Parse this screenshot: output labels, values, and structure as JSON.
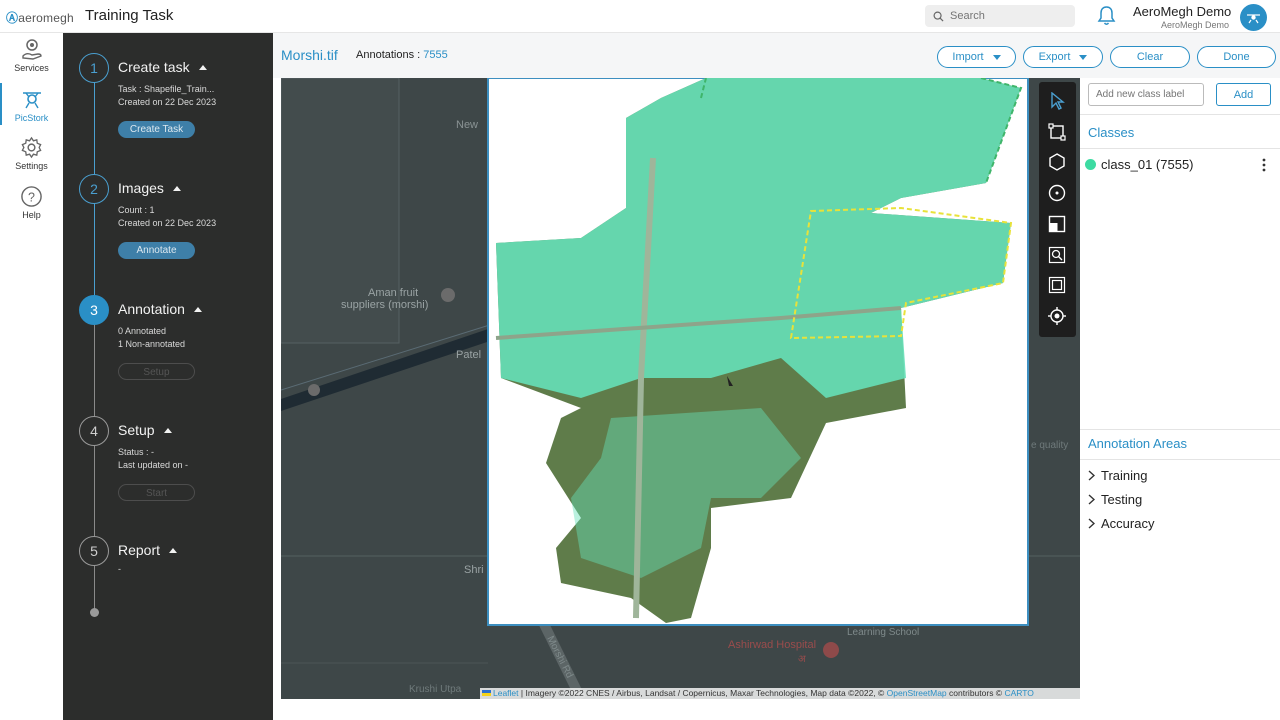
{
  "app": {
    "logo": "aeromegh",
    "title": "Training Task"
  },
  "search": {
    "placeholder": "Search"
  },
  "user": {
    "name": "AeroMegh Demo",
    "subtitle": "AeroMegh Demo"
  },
  "nav": {
    "services": "Services",
    "picstork": "PicStork",
    "settings": "Settings",
    "help": "Help"
  },
  "steps": [
    {
      "num": "1",
      "title": "Create task",
      "line1": "Task : Shapefile_Train...",
      "line2": "Created on 22 Dec 2023",
      "button": "Create Task"
    },
    {
      "num": "2",
      "title": "Images",
      "line1": "Count : 1",
      "line2": "Created on 22 Dec 2023",
      "button": "Annotate"
    },
    {
      "num": "3",
      "title": "Annotation",
      "line1": "0 Annotated",
      "line2": "1 Non-annotated",
      "button": "Setup"
    },
    {
      "num": "4",
      "title": "Setup",
      "line1": "Status : -",
      "line2": "Last updated on -",
      "button": "Start"
    },
    {
      "num": "5",
      "title": "Report",
      "line1": "-"
    }
  ],
  "header": {
    "filename": "Morshi.tif",
    "annotations_label": "Annotations :",
    "annotations_count": "7555",
    "import": "Import",
    "export": "Export",
    "clear": "Clear",
    "done": "Done"
  },
  "map": {
    "labels": {
      "new": "New",
      "aman1": "Aman fruit",
      "aman2": "suppliers (morshi)",
      "patel": "Patel",
      "shri": "Shri",
      "learning": "Learning School",
      "ashirwad": "Ashirwad Hospital",
      "ashirwad_sub": "अ",
      "morshi_rd": "Morshi Rd",
      "krushi": "Krushi Utpa",
      "quality": "e quality"
    },
    "attribution": {
      "leaflet": "Leaflet",
      "text1": " | Imagery ©2022 CNES / Airbus, Landsat / Copernicus, Maxar Technologies, Map data ©2022, © ",
      "osm": "OpenStreetMap",
      "text2": " contributors © ",
      "carto": "CARTO"
    }
  },
  "tools": [
    "select-icon",
    "rectangle-icon",
    "polygon-icon",
    "circle-icon",
    "split-view-icon",
    "zoom-icon",
    "fit-icon",
    "locate-icon"
  ],
  "right": {
    "class_placeholder": "Add new class label",
    "add": "Add",
    "classes_title": "Classes",
    "classes": [
      {
        "label": "class_01 (7555)",
        "color": "#3ddba2"
      }
    ],
    "areas_title": "Annotation Areas",
    "areas": [
      "Training",
      "Testing",
      "Accuracy"
    ]
  },
  "colors": {
    "accent": "#2a8fc6",
    "annotation": "#3ddba2",
    "panel": "#2c2d2c"
  }
}
